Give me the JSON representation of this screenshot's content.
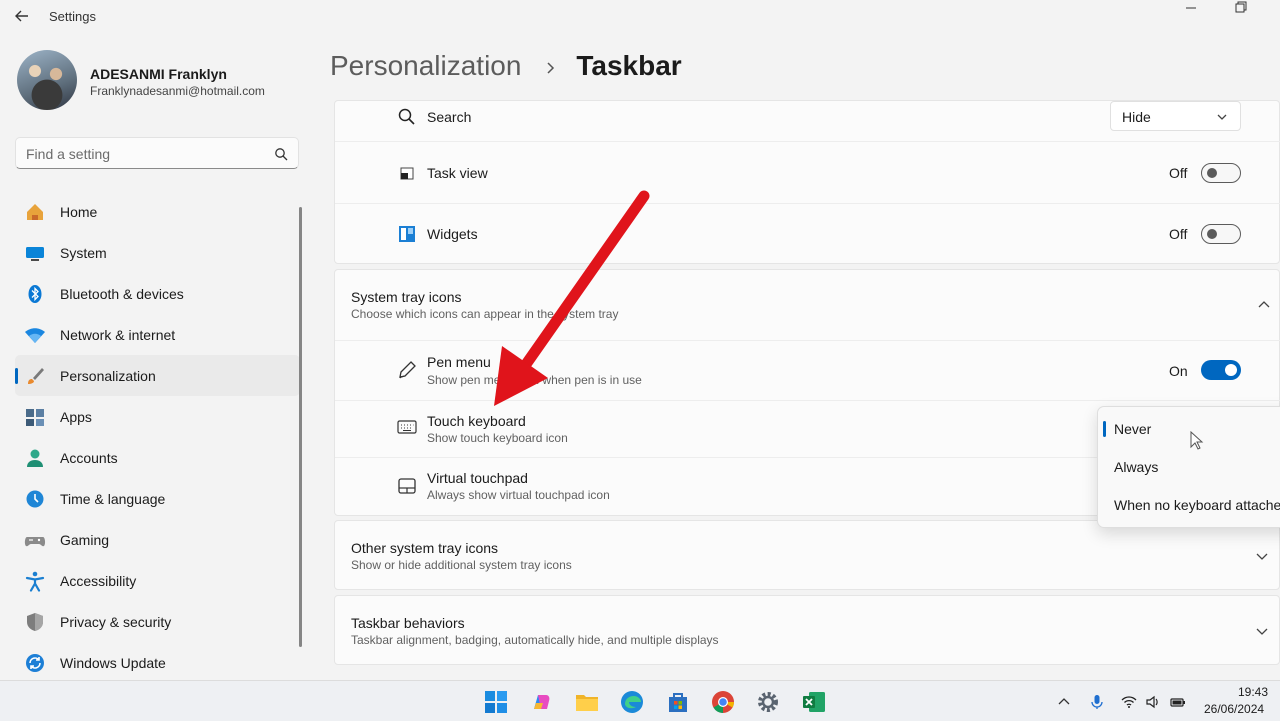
{
  "window": {
    "title": "Settings"
  },
  "profile": {
    "name": "ADESANMI Franklyn",
    "email": "Franklynadesanmi@hotmail.com"
  },
  "search": {
    "placeholder": "Find a setting"
  },
  "nav": [
    {
      "label": "Home",
      "icon": "home-icon"
    },
    {
      "label": "System",
      "icon": "system-icon"
    },
    {
      "label": "Bluetooth & devices",
      "icon": "bluetooth-icon"
    },
    {
      "label": "Network & internet",
      "icon": "wifi-icon"
    },
    {
      "label": "Personalization",
      "icon": "brush-icon",
      "active": true
    },
    {
      "label": "Apps",
      "icon": "apps-icon"
    },
    {
      "label": "Accounts",
      "icon": "accounts-icon"
    },
    {
      "label": "Time & language",
      "icon": "time-language-icon"
    },
    {
      "label": "Gaming",
      "icon": "gaming-icon"
    },
    {
      "label": "Accessibility",
      "icon": "accessibility-icon"
    },
    {
      "label": "Privacy & security",
      "icon": "shield-icon"
    },
    {
      "label": "Windows Update",
      "icon": "windows-update-icon"
    }
  ],
  "breadcrumb": {
    "parent": "Personalization",
    "current": "Taskbar"
  },
  "taskbar_items": {
    "search": {
      "label": "Search",
      "value": "Hide"
    },
    "task_view": {
      "label": "Task view",
      "state": "Off"
    },
    "widgets": {
      "label": "Widgets",
      "state": "Off"
    }
  },
  "system_tray": {
    "title": "System tray icons",
    "subtitle": "Choose which icons can appear in the system tray",
    "pen_menu": {
      "title": "Pen menu",
      "subtitle": "Show pen menu icon when pen is in use",
      "state": "On"
    },
    "touch_keyboard": {
      "title": "Touch keyboard",
      "subtitle": "Show touch keyboard icon"
    },
    "virtual_touchpad": {
      "title": "Virtual touchpad",
      "subtitle": "Always show virtual touchpad icon"
    }
  },
  "flyout": {
    "options": [
      "Never",
      "Always",
      "When no keyboard attached"
    ],
    "selected": "Never"
  },
  "other_tray": {
    "title": "Other system tray icons",
    "subtitle": "Show or hide additional system tray icons"
  },
  "behaviors": {
    "title": "Taskbar behaviors",
    "subtitle": "Taskbar alignment, badging, automatically hide, and multiple displays"
  },
  "clock": {
    "time": "19:43",
    "date": "26/06/2024"
  },
  "colors": {
    "accent": "#0067c0",
    "annotation_arrow": "#e0141b"
  }
}
